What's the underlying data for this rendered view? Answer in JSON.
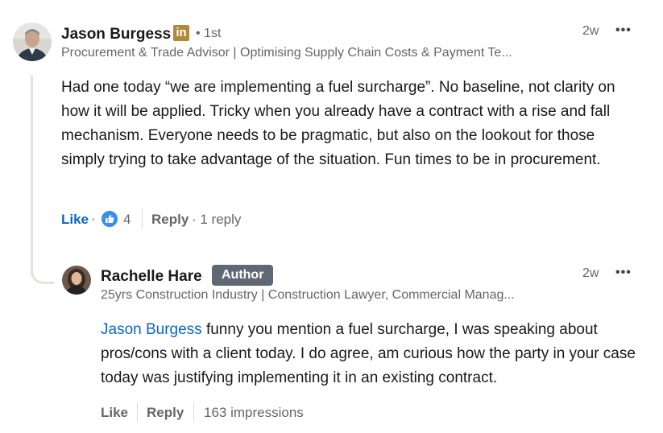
{
  "comment": {
    "author": {
      "name": "Jason Burgess",
      "badge_letters": "in",
      "connection": "• 1st",
      "headline": "Procurement & Trade Advisor | Optimising Supply Chain Costs & Payment Te..."
    },
    "time": "2w",
    "more": "•••",
    "text": "Had one today “we are implementing a fuel surcharge”. No baseline, not clarity on how it will be applied. Tricky when you already have a contract with a rise and fall mechanism. Everyone needs to be pragmatic, but also on the lookout for those simply trying to take advantage of the situation. Fun times to be in procurement.",
    "actions": {
      "like": "Like",
      "dot": "·",
      "reaction_count": "4",
      "reply": "Reply",
      "replies": "· 1 reply"
    }
  },
  "reply": {
    "author": {
      "name": "Rachelle Hare",
      "badge": "Author",
      "headline": "25yrs Construction Industry | Construction Lawyer, Commercial Manag..."
    },
    "time": "2w",
    "more": "•••",
    "mention": "Jason Burgess",
    "text": " funny you mention a fuel surcharge, I was speaking about pros/cons with a client today. I do agree, am curious how the party in your case today was justifying implementing it in an existing contract.",
    "actions": {
      "like": "Like",
      "reply": "Reply",
      "impressions": "163 impressions"
    }
  },
  "colors": {
    "link_blue": "#0a66c2",
    "linkedin_premium_gold": "#b08a38",
    "author_badge_bg": "#5e6973",
    "thread_line": "#e8e3da"
  }
}
